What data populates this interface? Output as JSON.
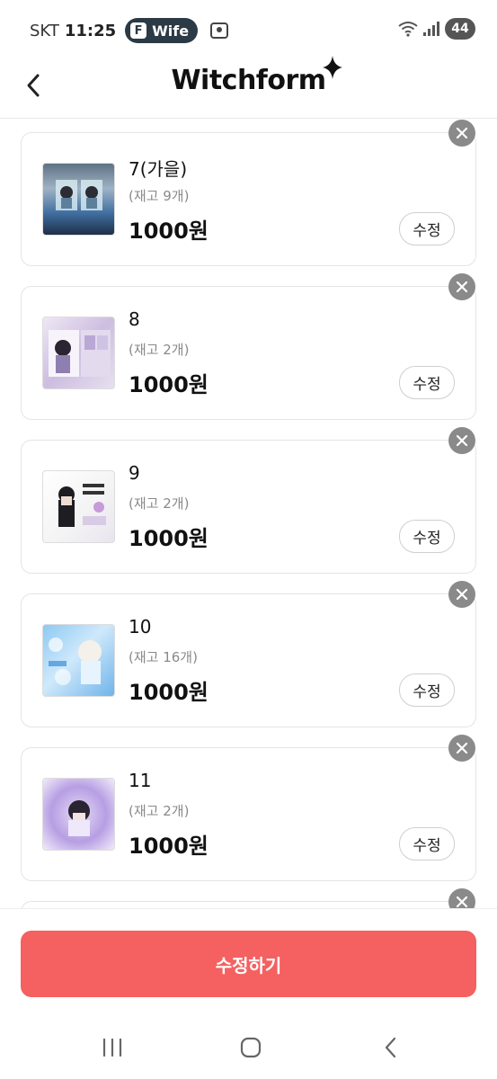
{
  "status_bar": {
    "carrier": "SKT",
    "time": "11:25",
    "app_pill_letter": "F",
    "app_pill_label": "Wifе",
    "battery": "44",
    "icons": [
      "screenshot-icon",
      "wifi-icon",
      "signal-icon",
      "battery-icon"
    ]
  },
  "header": {
    "back_icon": "chevron-left-icon",
    "logo": "Witchform"
  },
  "items": [
    {
      "name": "7(가을)",
      "stock": "(재고 9개)",
      "price": "1000원",
      "edit_label": "수정"
    },
    {
      "name": "8",
      "stock": "(재고 2개)",
      "price": "1000원",
      "edit_label": "수정"
    },
    {
      "name": "9",
      "stock": "(재고 2개)",
      "price": "1000원",
      "edit_label": "수정"
    },
    {
      "name": "10",
      "stock": "(재고 16개)",
      "price": "1000원",
      "edit_label": "수정"
    },
    {
      "name": "11",
      "stock": "(재고 2개)",
      "price": "1000원",
      "edit_label": "수정"
    }
  ],
  "submit_label": "수정하기",
  "colors": {
    "accent": "#f56060",
    "remove": "#8a8a8a",
    "muted_text": "#8a8a8a"
  },
  "nav": {
    "icons": [
      "recent-apps-icon",
      "home-icon",
      "back-icon"
    ]
  }
}
